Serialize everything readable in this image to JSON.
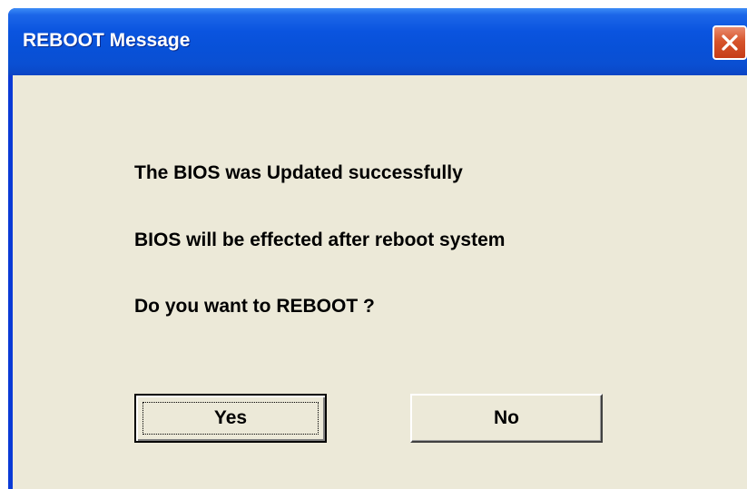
{
  "window": {
    "title": "REBOOT Message",
    "close_icon": "close-icon"
  },
  "message": {
    "line1": "The BIOS was Updated successfully",
    "line2": "BIOS will be effected after reboot system",
    "line3": "Do you want to REBOOT ?"
  },
  "buttons": {
    "yes_label": "Yes",
    "no_label": "No"
  },
  "colors": {
    "title_bar": "#0a54df",
    "close_button": "#d6542c",
    "client_background": "#ece9d8"
  }
}
